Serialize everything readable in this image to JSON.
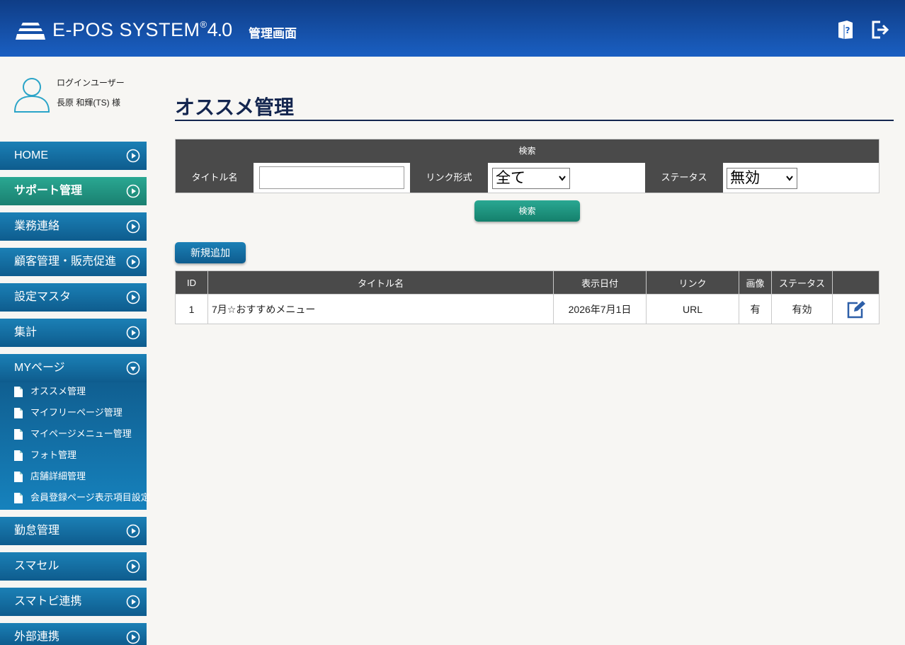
{
  "header": {
    "logo_text": "E-POS SYSTEM",
    "logo_reg": "®",
    "logo_version": "4.0",
    "logo_subtitle": "管理画面",
    "help_icon": "help-book-icon",
    "logout_icon": "logout-icon"
  },
  "user": {
    "label": "ログインユーザー",
    "name": "長原 和輝(TS) 様"
  },
  "sidebar": {
    "items": [
      {
        "label": "HOME"
      },
      {
        "label": "サポート管理"
      },
      {
        "label": "業務連絡"
      },
      {
        "label": "顧客管理・販売促進"
      },
      {
        "label": "設定マスタ"
      },
      {
        "label": "集計"
      },
      {
        "label": "MYページ"
      },
      {
        "label": "勤怠管理"
      },
      {
        "label": "スマセル"
      },
      {
        "label": "スマトピ連携"
      },
      {
        "label": "外部連携"
      }
    ],
    "submenu": [
      {
        "label": "オススメ管理"
      },
      {
        "label": "マイフリーページ管理"
      },
      {
        "label": "マイページメニュー管理"
      },
      {
        "label": "フォト管理"
      },
      {
        "label": "店舗詳細管理"
      },
      {
        "label": "会員登録ページ表示項目設定"
      }
    ]
  },
  "main": {
    "title": "オススメ管理",
    "search": {
      "header": "検索",
      "title_label": "タイトル名",
      "title_value": "",
      "link_label": "リンク形式",
      "link_selected": "全て",
      "status_label": "ステータス",
      "status_selected": "無効",
      "button": "検索"
    },
    "add_button": "新規追加",
    "table": {
      "headers": [
        "ID",
        "タイトル名",
        "表示日付",
        "リンク",
        "画像",
        "ステータス",
        ""
      ],
      "rows": [
        {
          "id": "1",
          "title": "7月☆おすすめメニュー",
          "date": "2026年7月1日",
          "link": "URL",
          "image": "有",
          "status": "有効"
        }
      ]
    }
  },
  "colors": {
    "header_blue": "#1a5fc2",
    "nav_blue": "#1b80b6",
    "nav_active_teal": "#2aa892",
    "title_navy": "#14264f",
    "table_head": "#4a4a4a"
  }
}
